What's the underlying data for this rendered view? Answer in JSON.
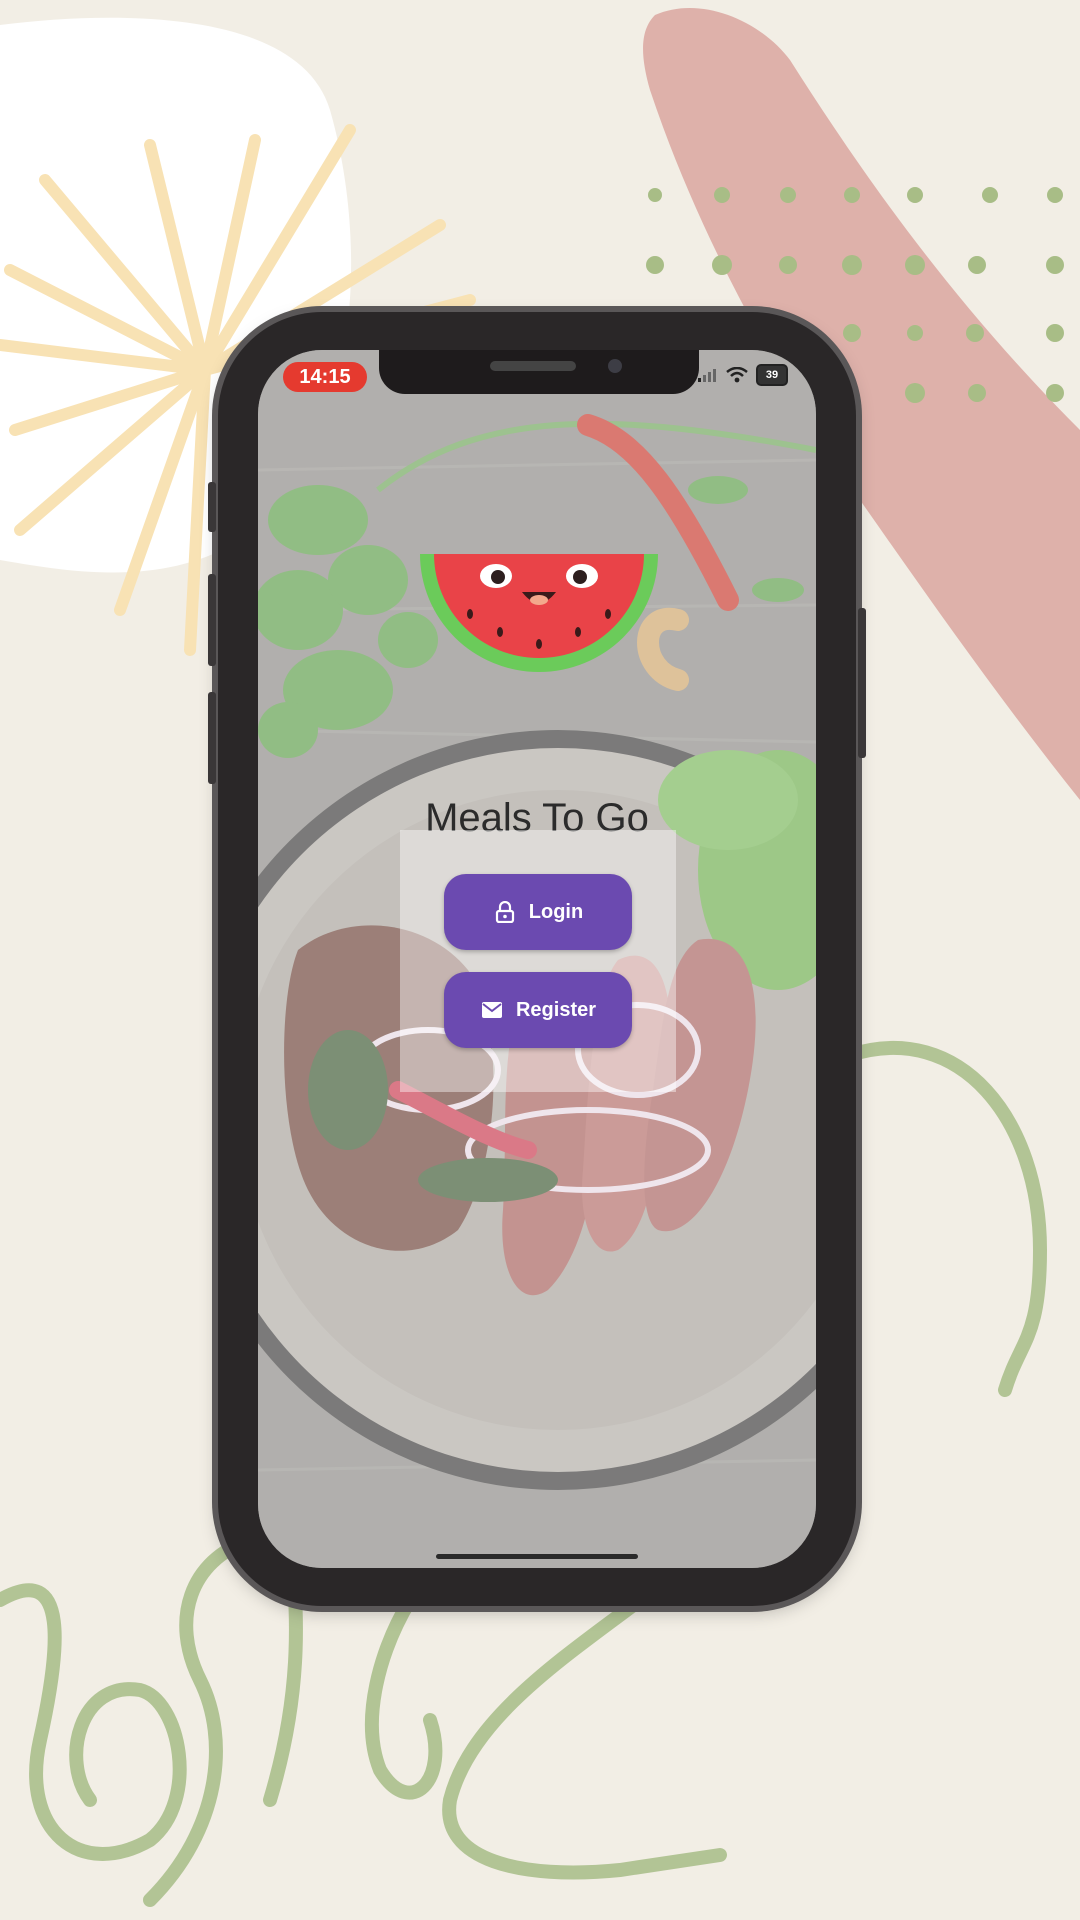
{
  "status_bar": {
    "time": "14:15",
    "battery": "39"
  },
  "app": {
    "title": "Meals To Go"
  },
  "buttons": {
    "login_label": "Login",
    "register_label": "Register"
  },
  "icons": {
    "login": "lock-icon",
    "register": "email-icon",
    "mascot": "watermelon-icon"
  },
  "colors": {
    "primary": "#6b4ab0",
    "time_pill": "#e53a2f",
    "page_background": "#f2eee5"
  }
}
